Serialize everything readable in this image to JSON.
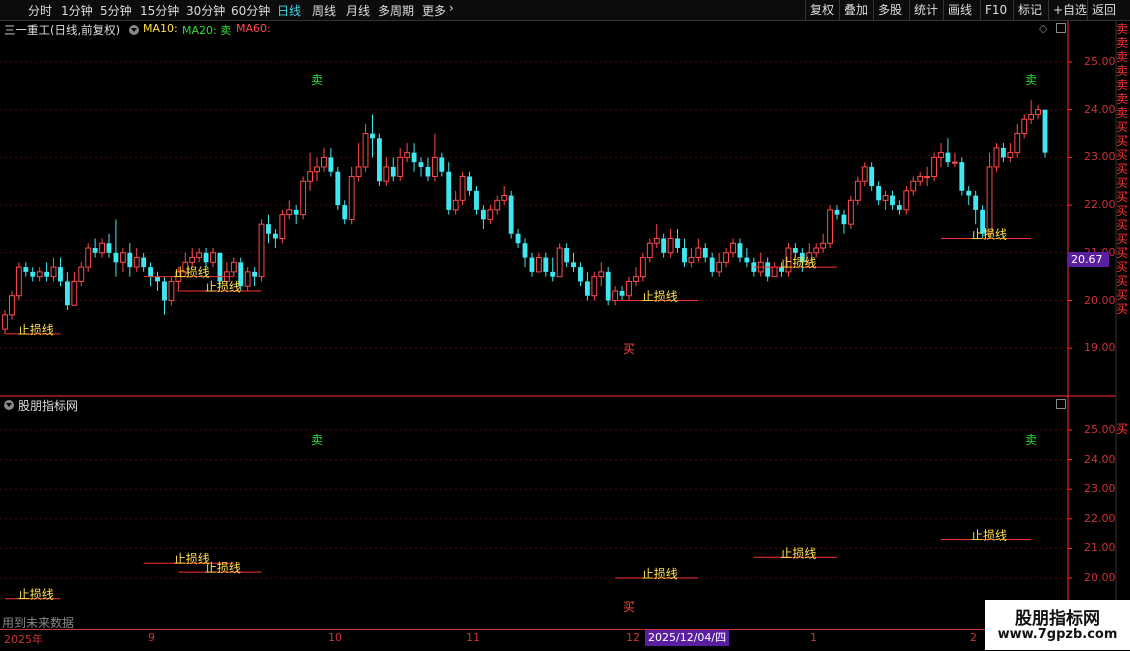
{
  "toolbar": {
    "timeframes": [
      "分时",
      "1分钟",
      "5分钟",
      "15分钟",
      "30分钟",
      "60分钟",
      "日线",
      "周线",
      "月线",
      "多周期",
      "更多"
    ],
    "active": "日线",
    "right_buttons": [
      "复权",
      "叠加",
      "多股",
      "统计",
      "画线",
      "F10",
      "标记",
      "+自选",
      "返回"
    ]
  },
  "main_chart": {
    "title": "三一重工(日线,前复权)",
    "ma10": "MA10:",
    "ma20": "MA20: 卖",
    "ma60": "MA60:",
    "price_badge": "20.67",
    "buy_label": "买",
    "sell_label": "卖",
    "stop_label": "止损线"
  },
  "sub_chart": {
    "title": "股朋指标网",
    "footer_note": "用到未来数据",
    "buy_label": "买",
    "sell_label": "卖",
    "stop_label": "止损线"
  },
  "x_axis": {
    "labels": [
      "2025年",
      "9",
      "10",
      "11",
      "12",
      "1",
      "2"
    ],
    "cursor_date": "2025/12/04/四"
  },
  "right_strip": {
    "main_text": "卖卖卖卖卖卖卖买买买买买买买买买买买买买买",
    "sub_text": "买"
  },
  "watermark": {
    "line1": "股朋指标网",
    "line2": "www.7gpzb.com"
  },
  "colors": {
    "up": "#ff4a4a",
    "down": "#3fe8f0",
    "grid": "#4a0a0a",
    "axis": "#ff3030",
    "stop": "#ff3030",
    "stop_text": "#ffe14a",
    "sell": "#33dd33",
    "buy": "#ff4444",
    "badge": "#5a1fa0"
  },
  "chart_data": {
    "type": "candlestick",
    "y_ticks": [
      "25.00",
      "24.00",
      "23.00",
      "22.00",
      "21.00",
      "20.00",
      "19.00"
    ],
    "sub_y_ticks": [
      "25.00",
      "24.00",
      "23.00",
      "22.00",
      "21.00",
      "20.00"
    ],
    "ylim": [
      18.0,
      26.0
    ],
    "candles": [
      [
        19.4,
        19.7,
        19.3,
        19.8
      ],
      [
        19.7,
        20.1,
        19.6,
        20.2
      ],
      [
        20.1,
        20.7,
        20.0,
        20.8
      ],
      [
        20.7,
        20.6,
        20.5,
        20.8
      ],
      [
        20.6,
        20.5,
        20.4,
        20.7
      ],
      [
        20.5,
        20.6,
        20.4,
        20.7
      ],
      [
        20.6,
        20.5,
        20.4,
        20.8
      ],
      [
        20.5,
        20.7,
        20.4,
        20.9
      ],
      [
        20.7,
        20.4,
        20.3,
        20.9
      ],
      [
        20.4,
        19.9,
        19.8,
        20.6
      ],
      [
        19.9,
        20.4,
        19.9,
        20.6
      ],
      [
        20.4,
        20.7,
        20.3,
        20.8
      ],
      [
        20.7,
        21.1,
        20.6,
        21.2
      ],
      [
        21.1,
        21.0,
        20.9,
        21.3
      ],
      [
        21.0,
        21.2,
        20.9,
        21.3
      ],
      [
        21.2,
        21.0,
        20.9,
        21.4
      ],
      [
        21.0,
        20.8,
        20.5,
        21.7
      ],
      [
        20.8,
        21.0,
        20.6,
        21.1
      ],
      [
        21.0,
        20.7,
        20.5,
        21.2
      ],
      [
        20.7,
        20.9,
        20.6,
        21.1
      ],
      [
        20.9,
        20.7,
        20.6,
        21.0
      ],
      [
        20.7,
        20.5,
        20.3,
        20.8
      ],
      [
        20.5,
        20.4,
        20.2,
        20.6
      ],
      [
        20.4,
        20.0,
        19.7,
        20.5
      ],
      [
        20.0,
        20.4,
        19.9,
        20.5
      ],
      [
        20.4,
        20.6,
        20.2,
        20.7
      ],
      [
        20.6,
        20.8,
        20.5,
        21.0
      ],
      [
        20.8,
        20.9,
        20.7,
        21.1
      ],
      [
        20.9,
        21.0,
        20.8,
        21.1
      ],
      [
        21.0,
        20.8,
        20.7,
        21.1
      ],
      [
        20.8,
        21.0,
        20.7,
        21.1
      ],
      [
        21.0,
        20.4,
        20.3,
        21.0
      ],
      [
        20.4,
        20.6,
        20.3,
        20.8
      ],
      [
        20.6,
        20.8,
        20.5,
        20.9
      ],
      [
        20.8,
        20.3,
        20.2,
        20.9
      ],
      [
        20.3,
        20.6,
        20.2,
        20.7
      ],
      [
        20.6,
        20.5,
        20.3,
        20.7
      ],
      [
        20.5,
        21.6,
        20.4,
        21.7
      ],
      [
        21.6,
        21.4,
        21.2,
        21.8
      ],
      [
        21.4,
        21.3,
        21.1,
        21.5
      ],
      [
        21.3,
        21.8,
        21.2,
        21.9
      ],
      [
        21.8,
        21.9,
        21.7,
        22.1
      ],
      [
        21.9,
        21.8,
        21.6,
        22.0
      ],
      [
        21.8,
        22.5,
        21.7,
        22.6
      ],
      [
        22.5,
        22.7,
        22.3,
        23.1
      ],
      [
        22.7,
        22.8,
        22.5,
        23.0
      ],
      [
        22.8,
        23.0,
        22.7,
        23.2
      ],
      [
        23.0,
        22.7,
        22.6,
        23.2
      ],
      [
        22.7,
        22.0,
        21.9,
        22.8
      ],
      [
        22.0,
        21.7,
        21.6,
        22.1
      ],
      [
        21.7,
        22.6,
        21.6,
        22.8
      ],
      [
        22.6,
        22.8,
        22.5,
        23.3
      ],
      [
        22.8,
        23.5,
        22.7,
        23.7
      ],
      [
        23.5,
        23.4,
        23.0,
        23.9
      ],
      [
        23.4,
        22.5,
        22.4,
        23.5
      ],
      [
        22.5,
        22.8,
        22.4,
        23.0
      ],
      [
        22.8,
        22.6,
        22.5,
        23.0
      ],
      [
        22.6,
        23.0,
        22.5,
        23.2
      ],
      [
        23.0,
        23.1,
        22.9,
        23.3
      ],
      [
        23.1,
        22.9,
        22.7,
        23.3
      ],
      [
        22.9,
        22.8,
        22.6,
        23.0
      ],
      [
        22.8,
        22.6,
        22.5,
        23.0
      ],
      [
        22.6,
        23.0,
        22.5,
        23.5
      ],
      [
        23.0,
        22.7,
        22.6,
        23.1
      ],
      [
        22.7,
        21.9,
        21.8,
        22.9
      ],
      [
        21.9,
        22.1,
        21.8,
        22.3
      ],
      [
        22.1,
        22.6,
        22.0,
        22.7
      ],
      [
        22.6,
        22.3,
        22.2,
        22.7
      ],
      [
        22.3,
        21.9,
        21.8,
        22.4
      ],
      [
        21.9,
        21.7,
        21.5,
        22.0
      ],
      [
        21.7,
        21.9,
        21.6,
        22.0
      ],
      [
        21.9,
        22.1,
        21.8,
        22.2
      ],
      [
        22.1,
        22.2,
        22.0,
        22.4
      ],
      [
        22.2,
        21.4,
        21.3,
        22.3
      ],
      [
        21.4,
        21.2,
        21.1,
        21.5
      ],
      [
        21.2,
        20.9,
        20.7,
        21.3
      ],
      [
        20.9,
        20.6,
        20.5,
        21.0
      ],
      [
        20.6,
        20.9,
        20.6,
        21.0
      ],
      [
        20.9,
        20.6,
        20.5,
        21.0
      ],
      [
        20.6,
        20.5,
        20.4,
        20.9
      ],
      [
        20.5,
        21.1,
        20.5,
        21.2
      ],
      [
        21.1,
        20.8,
        20.7,
        21.2
      ],
      [
        20.8,
        20.7,
        20.6,
        21.0
      ],
      [
        20.7,
        20.4,
        20.3,
        20.8
      ],
      [
        20.4,
        20.1,
        20.0,
        20.6
      ],
      [
        20.1,
        20.5,
        20.0,
        20.6
      ],
      [
        20.5,
        20.6,
        20.3,
        20.8
      ],
      [
        20.6,
        20.0,
        19.9,
        20.7
      ],
      [
        20.0,
        20.2,
        19.9,
        20.3
      ],
      [
        20.2,
        20.1,
        20.0,
        20.3
      ],
      [
        20.1,
        20.4,
        20.0,
        20.5
      ],
      [
        20.4,
        20.5,
        20.3,
        20.7
      ],
      [
        20.5,
        20.9,
        20.4,
        21.0
      ],
      [
        20.9,
        21.2,
        20.8,
        21.3
      ],
      [
        21.2,
        21.3,
        21.1,
        21.6
      ],
      [
        21.3,
        21.0,
        20.9,
        21.4
      ],
      [
        21.0,
        21.3,
        20.9,
        21.5
      ],
      [
        21.3,
        21.1,
        21.0,
        21.5
      ],
      [
        21.1,
        20.8,
        20.7,
        21.3
      ],
      [
        20.8,
        20.9,
        20.7,
        21.1
      ],
      [
        20.9,
        21.1,
        20.8,
        21.3
      ],
      [
        21.1,
        20.9,
        20.8,
        21.2
      ],
      [
        20.9,
        20.6,
        20.5,
        21.0
      ],
      [
        20.6,
        20.8,
        20.5,
        21.0
      ],
      [
        20.8,
        21.0,
        20.7,
        21.1
      ],
      [
        21.0,
        21.2,
        20.9,
        21.3
      ],
      [
        21.2,
        20.9,
        20.8,
        21.3
      ],
      [
        20.9,
        20.8,
        20.7,
        21.1
      ],
      [
        20.8,
        20.6,
        20.5,
        20.9
      ],
      [
        20.6,
        20.8,
        20.5,
        21.0
      ],
      [
        20.8,
        20.5,
        20.4,
        20.9
      ],
      [
        20.5,
        20.7,
        20.5,
        20.8
      ],
      [
        20.7,
        20.6,
        20.5,
        20.8
      ],
      [
        20.6,
        21.1,
        20.5,
        21.2
      ],
      [
        21.1,
        21.0,
        20.9,
        21.2
      ],
      [
        21.0,
        20.8,
        20.6,
        21.1
      ],
      [
        20.8,
        21.0,
        20.7,
        21.2
      ],
      [
        21.0,
        21.1,
        20.9,
        21.2
      ],
      [
        21.1,
        21.2,
        21.0,
        21.4
      ],
      [
        21.2,
        21.9,
        21.1,
        22.0
      ],
      [
        21.9,
        21.8,
        21.7,
        22.0
      ],
      [
        21.8,
        21.6,
        21.4,
        21.9
      ],
      [
        21.6,
        22.1,
        21.5,
        22.2
      ],
      [
        22.1,
        22.5,
        22.0,
        22.6
      ],
      [
        22.5,
        22.8,
        22.4,
        22.9
      ],
      [
        22.8,
        22.4,
        22.3,
        22.9
      ],
      [
        22.4,
        22.1,
        22.0,
        22.5
      ],
      [
        22.1,
        22.2,
        21.9,
        22.3
      ],
      [
        22.2,
        22.0,
        21.9,
        22.3
      ],
      [
        22.0,
        21.9,
        21.8,
        22.1
      ],
      [
        21.9,
        22.3,
        21.8,
        22.4
      ],
      [
        22.3,
        22.5,
        22.2,
        22.6
      ],
      [
        22.5,
        22.6,
        22.4,
        22.7
      ],
      [
        22.6,
        22.6,
        22.4,
        22.8
      ],
      [
        22.6,
        23.0,
        22.5,
        23.1
      ],
      [
        23.0,
        23.1,
        22.8,
        23.3
      ],
      [
        23.1,
        22.9,
        22.8,
        23.4
      ],
      [
        22.9,
        22.9,
        22.8,
        23.1
      ],
      [
        22.9,
        22.3,
        22.2,
        23.0
      ],
      [
        22.3,
        22.2,
        22.0,
        22.4
      ],
      [
        22.2,
        21.9,
        21.6,
        22.3
      ],
      [
        21.9,
        21.4,
        21.3,
        22.0
      ],
      [
        21.4,
        22.8,
        21.3,
        23.1
      ],
      [
        22.8,
        23.2,
        22.7,
        23.3
      ],
      [
        23.2,
        23.0,
        22.9,
        23.3
      ],
      [
        23.0,
        23.1,
        22.9,
        23.3
      ],
      [
        23.1,
        23.5,
        23.0,
        23.7
      ],
      [
        23.5,
        23.8,
        23.4,
        23.9
      ],
      [
        23.8,
        23.9,
        23.7,
        24.2
      ],
      [
        23.9,
        24.0,
        23.8,
        24.1
      ],
      [
        24.0,
        23.1,
        23.0,
        24.0
      ]
    ],
    "stop_lines": [
      {
        "price": 19.3,
        "start": 0,
        "end": 8
      },
      {
        "price": 20.5,
        "start": 20,
        "end": 33
      },
      {
        "price": 20.2,
        "start": 25,
        "end": 37
      },
      {
        "price": 20.0,
        "start": 88,
        "end": 100
      },
      {
        "price": 20.7,
        "start": 108,
        "end": 120
      },
      {
        "price": 21.3,
        "start": 135,
        "end": 148
      }
    ],
    "sell_signals": [
      {
        "index": 45
      },
      {
        "index": 148
      }
    ],
    "buy_signals": [
      {
        "index": 90
      }
    ]
  }
}
